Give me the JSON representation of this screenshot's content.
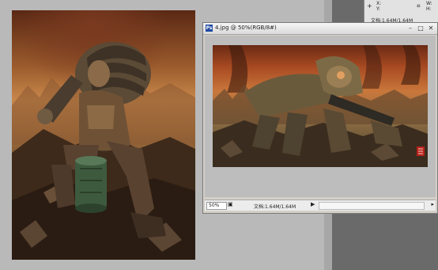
{
  "info_panel": {
    "x_label": "X:",
    "y_label": "Y:",
    "w_label": "W:",
    "h_label": "H:",
    "doc_status": "文档:1.64M/1.64M"
  },
  "document": {
    "title": "4.jpg @ 50%(RGB/8#)",
    "zoom": "50%",
    "status": "文档:1.64M/1.64M"
  }
}
